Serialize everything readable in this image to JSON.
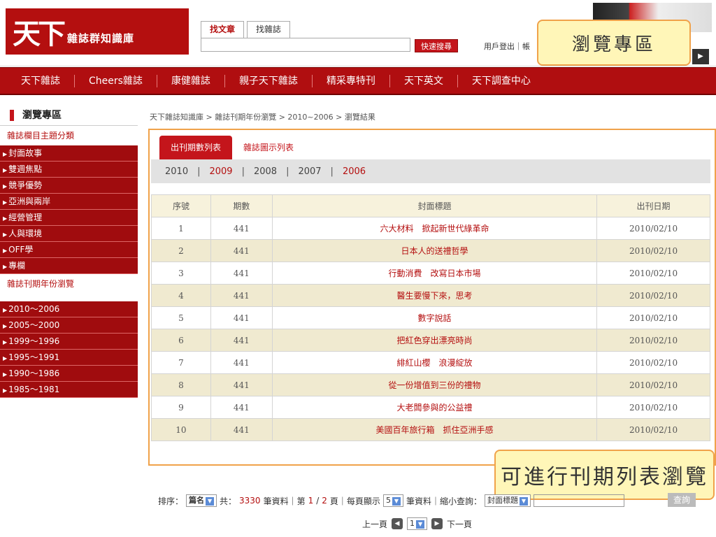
{
  "header": {
    "logo_mark": "天下",
    "logo_text": "雜誌群知識庫",
    "search_tabs": [
      "找文章",
      "找雜誌"
    ],
    "search_button": "快速搜尋",
    "user_links": "用戶登出｜帳"
  },
  "callouts": {
    "browse": "瀏覽專區",
    "list": "可進行刊期列表瀏覽"
  },
  "nav": [
    "天下雜誌",
    "Cheers雜誌",
    "康健雜誌",
    "親子天下雜誌",
    "精采專特刊",
    "天下英文",
    "天下調查中心"
  ],
  "sidebar": {
    "title": "瀏覽專區",
    "section1": "雜誌欄目主題分類",
    "categories": [
      "封面故事",
      "雙週焦點",
      "競爭優勢",
      "亞洲與兩岸",
      "經營管理",
      "人與環境",
      "OFF學",
      "專欄"
    ],
    "section2": "雜誌刊期年份瀏覽",
    "year_ranges": [
      "2010～2006",
      "2005～2000",
      "1999～1996",
      "1995～1991",
      "1990～1986",
      "1985～1981"
    ]
  },
  "breadcrumb": "天下雜誌知識庫 > 雜誌刊期年份瀏覽 > 2010~2006 > 瀏覽結果",
  "content": {
    "tabs": [
      "出刊期數列表",
      "雜誌圖示列表"
    ],
    "years": [
      "2010",
      "2009",
      "2008",
      "2007",
      "2006"
    ],
    "columns": [
      "序號",
      "期數",
      "封面標題",
      "出刊日期"
    ],
    "rows": [
      {
        "no": "1",
        "issue": "441",
        "title": "六大材料　掀起新世代綠革命",
        "date": "2010/02/10"
      },
      {
        "no": "2",
        "issue": "441",
        "title": "日本人的送禮哲學",
        "date": "2010/02/10"
      },
      {
        "no": "3",
        "issue": "441",
        "title": "行動消費　改寫日本市場",
        "date": "2010/02/10"
      },
      {
        "no": "4",
        "issue": "441",
        "title": "醫生要慢下來，思考",
        "date": "2010/02/10"
      },
      {
        "no": "5",
        "issue": "441",
        "title": "數字說話",
        "date": "2010/02/10"
      },
      {
        "no": "6",
        "issue": "441",
        "title": "把紅色穿出漂亮時尚",
        "date": "2010/02/10"
      },
      {
        "no": "7",
        "issue": "441",
        "title": "緋紅山櫻　浪漫綻放",
        "date": "2010/02/10"
      },
      {
        "no": "8",
        "issue": "441",
        "title": "從一份增值到三份的禮物",
        "date": "2010/02/10"
      },
      {
        "no": "9",
        "issue": "441",
        "title": "大老闆參與的公益禮",
        "date": "2010/02/10"
      },
      {
        "no": "10",
        "issue": "441",
        "title": "美國百年旅行箱　抓住亞洲手感",
        "date": "2010/02/10"
      }
    ]
  },
  "pager": {
    "sort_label": "排序：",
    "sort_value": "篇名",
    "total_prefix": "共：",
    "total": "3330",
    "total_suffix": "筆資料｜第",
    "page_current": "1",
    "page_sep": "/",
    "page_total": "2",
    "page_suffix": "頁｜每頁顯示",
    "per_page": "5",
    "per_page_suffix": "筆資料｜縮小查詢：",
    "filter_field": "封面標題",
    "query_button": "查詢",
    "prev": "上一頁",
    "page_select": "1",
    "next": "下一頁"
  }
}
